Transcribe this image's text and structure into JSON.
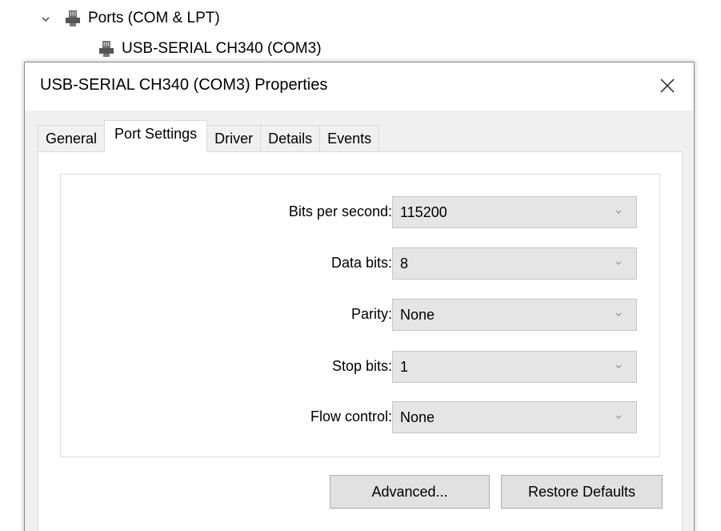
{
  "tree": {
    "category_label": "Ports (COM & LPT)",
    "device_label": "USB-SERIAL CH340 (COM3)"
  },
  "dialog": {
    "title": "USB-SERIAL CH340 (COM3) Properties",
    "tabs": [
      {
        "label": "General",
        "active": false
      },
      {
        "label": "Port Settings",
        "active": true
      },
      {
        "label": "Driver",
        "active": false
      },
      {
        "label": "Details",
        "active": false
      },
      {
        "label": "Events",
        "active": false
      }
    ],
    "fields": [
      {
        "label": "Bits per second:",
        "value": "115200"
      },
      {
        "label": "Data bits:",
        "value": "8"
      },
      {
        "label": "Parity:",
        "value": "None"
      },
      {
        "label": "Stop bits:",
        "value": "1"
      },
      {
        "label": "Flow control:",
        "value": "None"
      }
    ],
    "buttons": {
      "advanced": "Advanced...",
      "restore_defaults": "Restore Defaults"
    }
  }
}
